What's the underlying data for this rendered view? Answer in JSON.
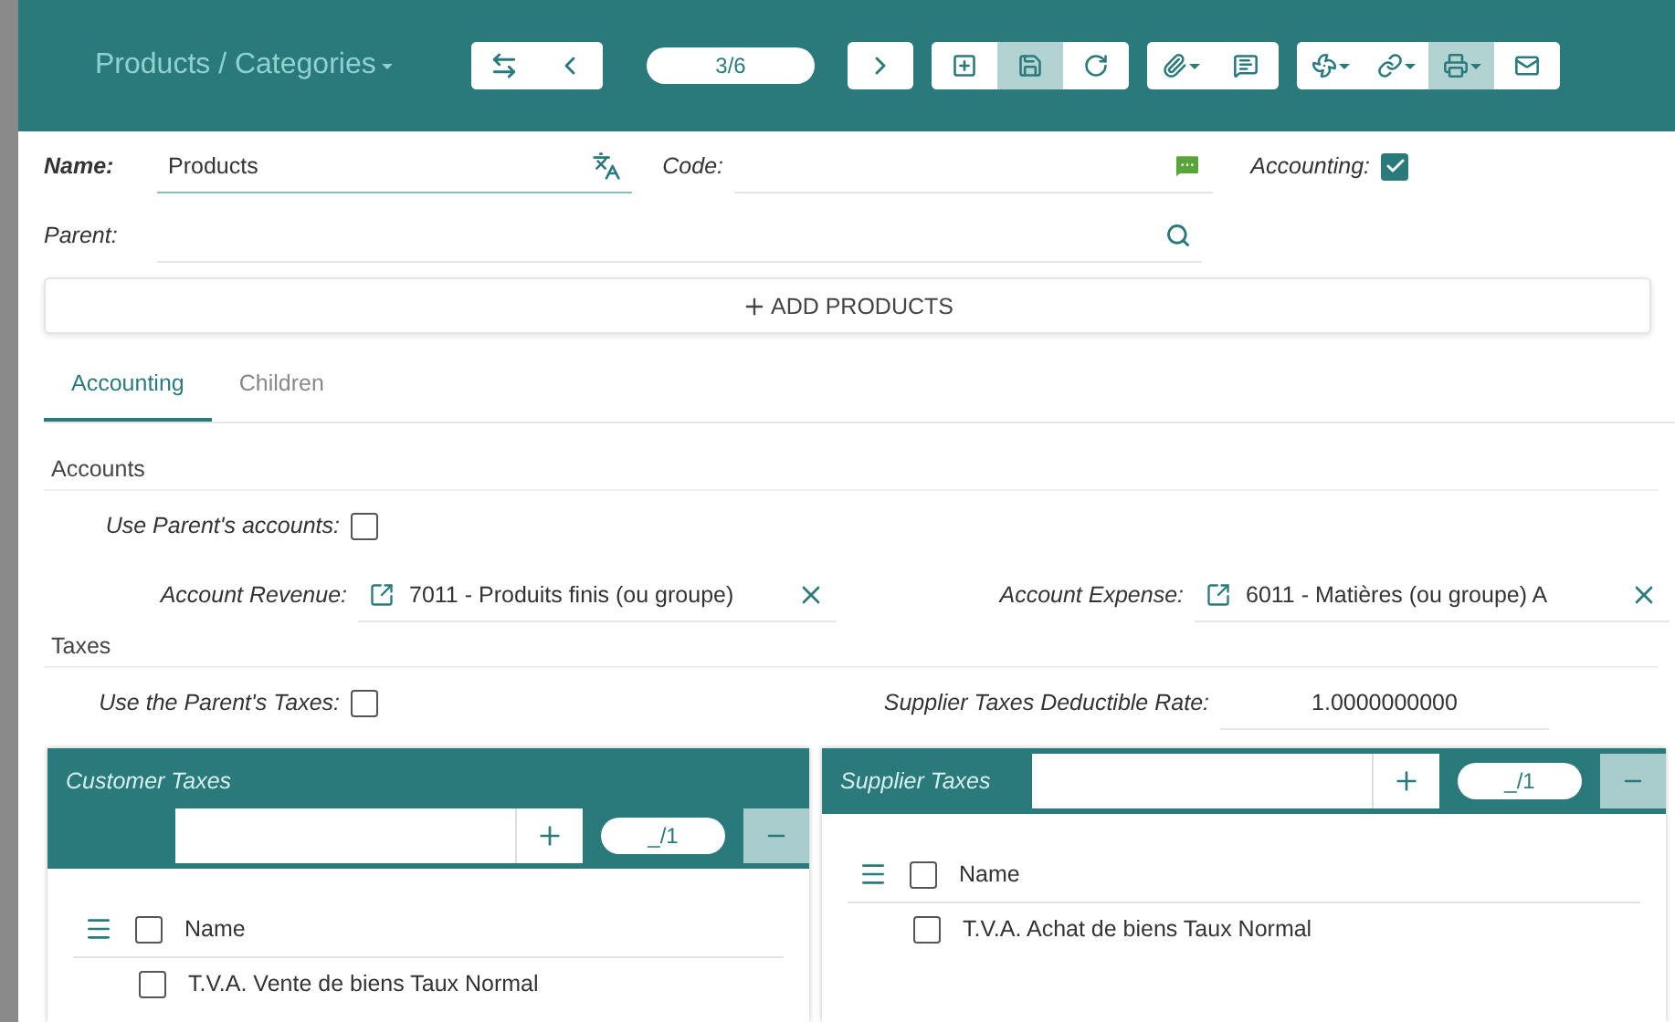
{
  "header": {
    "breadcrumb": "Products / Categories",
    "pager": "3/6",
    "toolbar_groups": [
      [
        {
          "pressed": false
        },
        {
          "pressed": false
        }
      ],
      [
        {
          "pressed": false
        }
      ],
      [
        {
          "pressed": false
        },
        {
          "pressed": true
        },
        {
          "pressed": false
        }
      ],
      [
        {
          "pressed": false
        },
        {
          "pressed": false
        }
      ],
      [
        {
          "pressed": false
        },
        {
          "pressed": false
        },
        {
          "pressed": true
        },
        {
          "pressed": false
        }
      ]
    ]
  },
  "form": {
    "name": {
      "label": "Name:",
      "value": "Products"
    },
    "code": {
      "label": "Code:"
    },
    "accounting": {
      "label": "Accounting:",
      "checked": true
    },
    "parent": {
      "label": "Parent:"
    }
  },
  "add_button": "ADD PRODUCTS",
  "tabs": [
    {
      "label": "Accounting",
      "selected": true
    },
    {
      "label": "Children",
      "selected": false
    }
  ],
  "accounts": {
    "title": "Accounts",
    "use_parent": {
      "label": "Use Parent's accounts:",
      "checked": false
    },
    "revenue": {
      "label": "Account Revenue:",
      "value": "7011 - Produits finis (ou groupe)"
    },
    "expense": {
      "label": "Account Expense:",
      "value": "6011 - Matières (ou groupe) A"
    }
  },
  "taxes": {
    "title": "Taxes",
    "use_parent": {
      "label": "Use the Parent's Taxes:",
      "checked": false
    },
    "rate": {
      "label": "Supplier Taxes Deductible Rate:",
      "value": "1.0000000000"
    }
  },
  "panels": [
    {
      "title": "Customer Taxes",
      "pager": "_/1",
      "column": "Name",
      "header_checked": false,
      "rows": [
        {
          "name": "T.V.A. Vente de biens Taux Normal",
          "checked": false
        }
      ]
    },
    {
      "title": "Supplier Taxes",
      "pager": "_/1",
      "column": "Name",
      "header_checked": false,
      "rows": [
        {
          "name": "T.V.A. Achat de biens Taux Normal",
          "checked": false
        }
      ]
    }
  ]
}
